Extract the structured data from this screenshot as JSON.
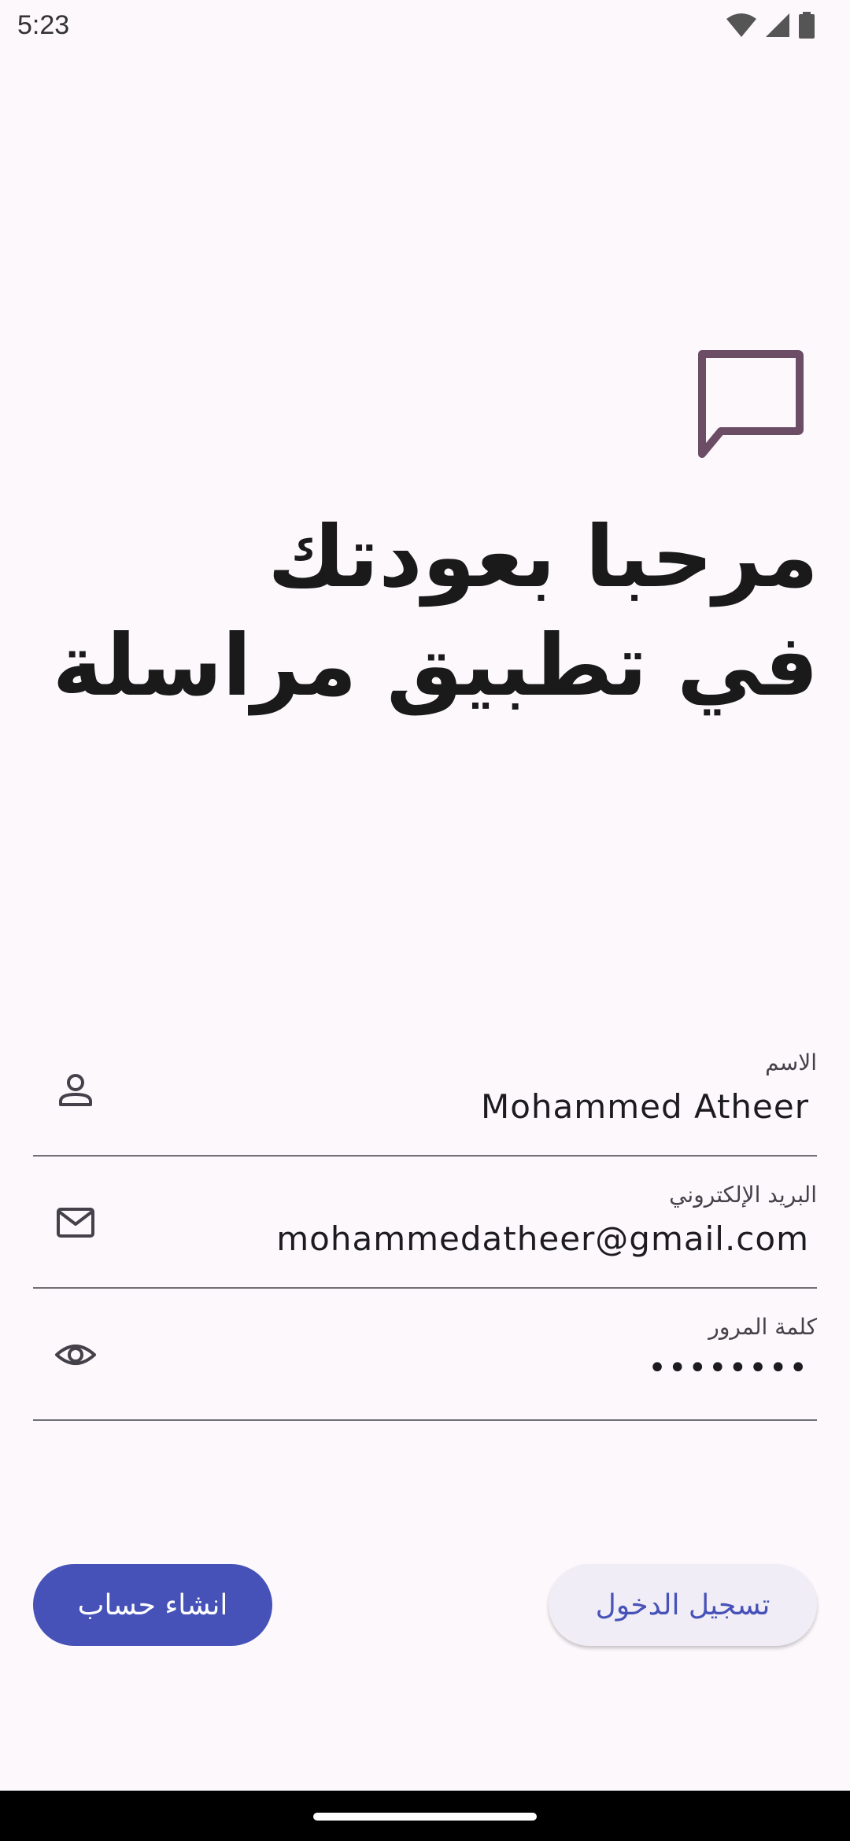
{
  "status_bar": {
    "time": "5:23",
    "icons": [
      "wifi-icon",
      "cellular-signal-icon",
      "battery-icon"
    ]
  },
  "logo": {
    "icon": "chat-bubble-icon",
    "color": "#6b4d66"
  },
  "title": {
    "line1": "مرحبا بعودتك",
    "line2": "في تطبيق مراسلة"
  },
  "form": {
    "name": {
      "label": "الاسم",
      "value": "Mohammed Atheer",
      "icon": "person-icon"
    },
    "email": {
      "label": "البريد الإلكتروني",
      "value": "mohammedatheer@gmail.com",
      "icon": "mail-icon"
    },
    "password": {
      "label": "كلمة المرور",
      "value": "••••••••",
      "icon": "eye-icon"
    }
  },
  "buttons": {
    "create_account": "انشاء حساب",
    "login": "تسجيل الدخول"
  },
  "colors": {
    "background": "#fdf8fc",
    "primary": "#4652b8",
    "secondary_button_bg": "#f1edf6",
    "logo": "#6b4d66",
    "text": "#1c1b1f"
  }
}
